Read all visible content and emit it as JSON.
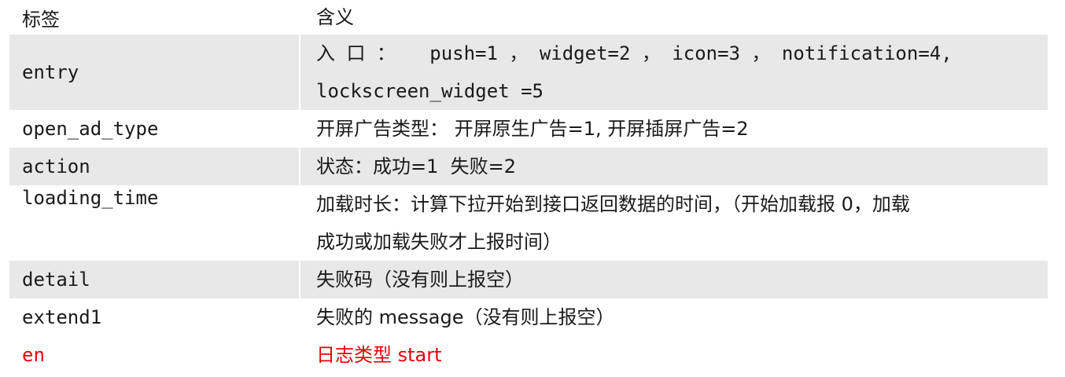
{
  "header": {
    "tag": "标签",
    "meaning": "含义"
  },
  "rows": [
    {
      "tag": "entry",
      "meaning_line1": "入 口 ：   push=1 ， widget=2 ， icon=3 ， notification=4,",
      "meaning_line2": "lockscreen_widget =5"
    },
    {
      "tag": "open_ad_type",
      "meaning": "开屏广告类型： 开屏原生广告=1, 开屏插屏广告=2"
    },
    {
      "tag": "action",
      "meaning": "状态：成功=1  失败=2"
    },
    {
      "tag": "loading_time",
      "meaning_line1": "加载时长：计算下拉开始到接口返回数据的时间，（开始加载报 0，加载",
      "meaning_line2": "成功或加载失败才上报时间）"
    },
    {
      "tag": "detail",
      "meaning": "失败码（没有则上报空）"
    },
    {
      "tag": "extend1",
      "meaning": "失败的 message（没有则上报空）"
    },
    {
      "tag": "en",
      "meaning": "日志类型 start",
      "color": "#e8000b"
    }
  ],
  "colors": {
    "shade": "#e8e8e8",
    "highlight": "#e8000b"
  }
}
